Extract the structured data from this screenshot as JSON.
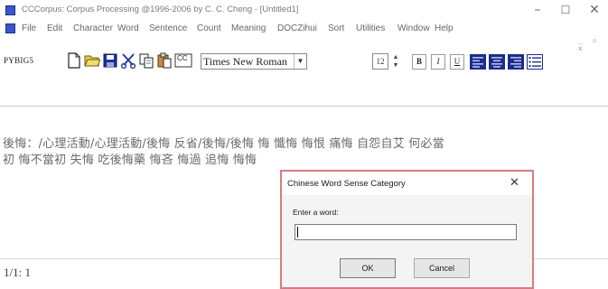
{
  "window": {
    "title": "CCCorpus: Corpus Processing  @1996-2006 by C. C. Cheng - [Untitled1]",
    "min_glyph": "–",
    "max_glyph": "☐",
    "close_glyph": "✕"
  },
  "menu": {
    "items": [
      "File",
      "Edit",
      "Character",
      "Word",
      "Sentence",
      "Count",
      "Meaning",
      "DOCZihui",
      "Sort",
      "Utilities",
      "Window",
      "Help"
    ],
    "mdi_controls": "_ ▫ x"
  },
  "toolbar": {
    "label": "PYBIG5",
    "cc_label": "CC",
    "font_name": "Times New Roman",
    "font_size": "12",
    "bold_label": "B",
    "italic_label": "I",
    "underline_label": "U",
    "spin_up": "▲",
    "spin_down": "▼",
    "dropdown_arrow": "▼"
  },
  "document": {
    "line1": "後悔：/心理活動/心理活動/後悔 反省/後悔/後悔 悔 懺悔 悔恨 痛悔 自怨自艾 何必當",
    "line2": "初 悔不當初 失悔 吃後悔藥 悔吝 悔過 追悔 悔悔"
  },
  "status": {
    "position": "1/1: 1"
  },
  "dialog": {
    "title": "Chinese Word Sense Category",
    "close_glyph": "✕",
    "prompt": "Enter a word:",
    "input_value": "",
    "ok_label": "OK",
    "cancel_label": "Cancel"
  }
}
